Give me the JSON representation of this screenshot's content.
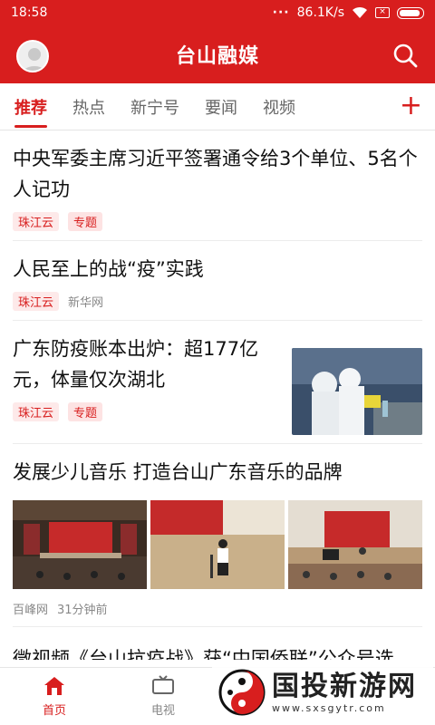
{
  "status": {
    "time": "18:58",
    "dots": "···",
    "speed": "86.1K/s"
  },
  "app": {
    "title": "台山融媒"
  },
  "tabs": [
    "推荐",
    "热点",
    "新宁号",
    "要闻",
    "视频"
  ],
  "feed": [
    {
      "headline": "中央军委主席习近平签署通令给3个单位、5名个人记功",
      "source": "珠江云",
      "tag": "专题"
    },
    {
      "headline": "人民至上的战“疫”实践",
      "source": "珠江云",
      "publisher": "新华网"
    },
    {
      "headline": "广东防疫账本出炉：超177亿元，体量仅次湖北",
      "source": "珠江云",
      "tag": "专题"
    },
    {
      "headline": "发展少儿音乐 打造台山广东音乐的品牌",
      "publisher": "百峰网",
      "time": "31分钟前"
    }
  ],
  "peek_headline": "微视频《台山抗疫战》获“中国侨联”公众号选",
  "bottom_nav": [
    {
      "label": "首页",
      "icon": "home-icon"
    },
    {
      "label": "电视",
      "icon": "tv-icon"
    }
  ],
  "watermark": {
    "title": "国投新游网",
    "url": "www.sxsgytr.com"
  },
  "colors": {
    "brand": "#d81e1e"
  }
}
